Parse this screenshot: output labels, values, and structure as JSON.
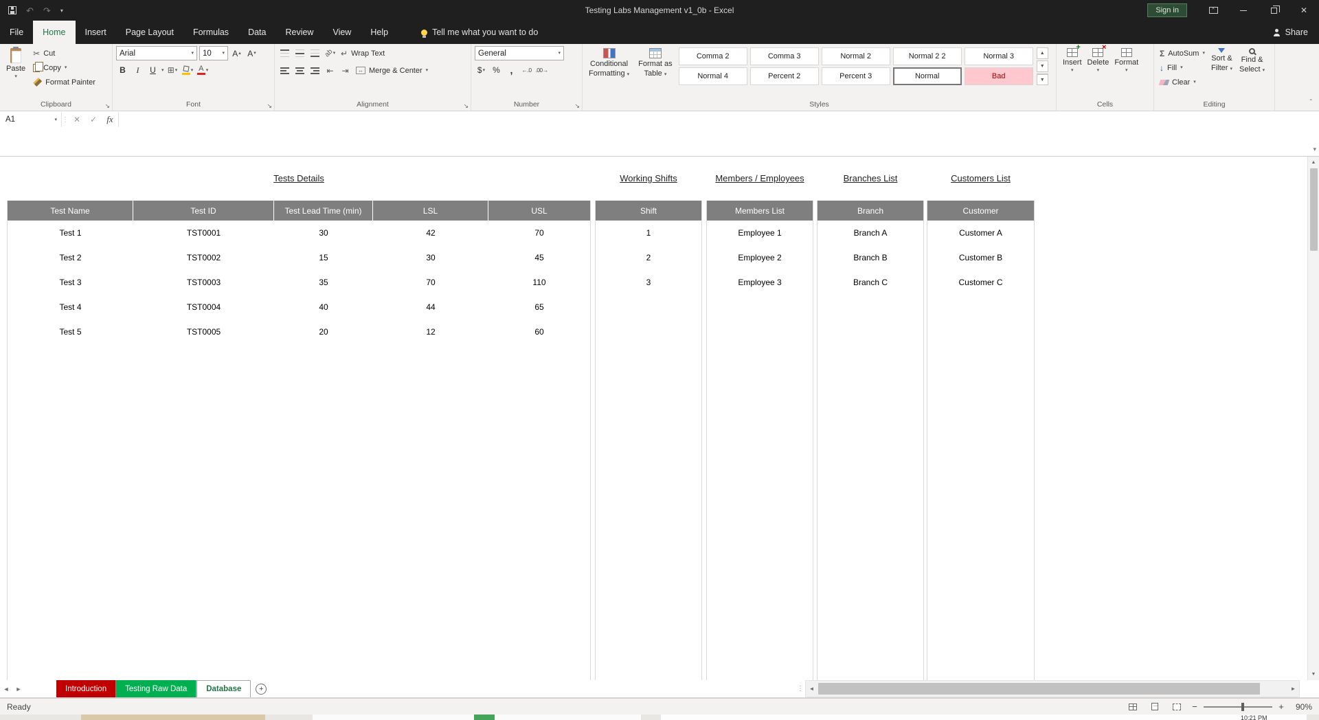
{
  "titlebar": {
    "title": "Testing Labs Management v1_0b  -  Excel",
    "sign_in": "Sign in"
  },
  "menu": {
    "tabs": [
      {
        "label": "File"
      },
      {
        "label": "Home"
      },
      {
        "label": "Insert"
      },
      {
        "label": "Page Layout"
      },
      {
        "label": "Formulas"
      },
      {
        "label": "Data"
      },
      {
        "label": "Review"
      },
      {
        "label": "View"
      },
      {
        "label": "Help"
      }
    ],
    "tell_me": "Tell me what you want to do",
    "share": "Share"
  },
  "ribbon": {
    "groups": [
      "Clipboard",
      "Font",
      "Alignment",
      "Number",
      "Styles",
      "Cells",
      "Editing"
    ],
    "clipboard": {
      "paste": "Paste",
      "cut": "Cut",
      "copy": "Copy",
      "format_painter": "Format Painter"
    },
    "font": {
      "name": "Arial",
      "size": "10"
    },
    "alignment": {
      "wrap": "Wrap Text",
      "merge": "Merge & Center"
    },
    "number": {
      "format": "General"
    },
    "styles": {
      "conditional": [
        "Conditional",
        "Formatting"
      ],
      "format_table": [
        "Format as",
        "Table"
      ],
      "gallery": [
        [
          "Comma 2",
          "Comma 3",
          "Normal 2",
          "Normal 2 2",
          "Normal 3"
        ],
        [
          "Normal 4",
          "Percent 2",
          "Percent 3",
          "Normal",
          "Bad"
        ]
      ]
    },
    "cells": {
      "insert": "Insert",
      "delete": "Delete",
      "format": "Format"
    },
    "editing": {
      "autosum": "AutoSum",
      "fill": "Fill",
      "clear": "Clear",
      "sort": [
        "Sort &",
        "Filter"
      ],
      "find": [
        "Find &",
        "Select"
      ]
    }
  },
  "formula_bar": {
    "name_box": "A1"
  },
  "sheet": {
    "sections": [
      {
        "title": "Tests Details",
        "columns": [
          "Test Name",
          "Test ID",
          "Test Lead Time (min)",
          "LSL",
          "USL"
        ],
        "rows": [
          [
            "Test 1",
            "TST0001",
            "30",
            "42",
            "70"
          ],
          [
            "Test 2",
            "TST0002",
            "15",
            "30",
            "45"
          ],
          [
            "Test 3",
            "TST0003",
            "35",
            "70",
            "110"
          ],
          [
            "Test 4",
            "TST0004",
            "40",
            "44",
            "65"
          ],
          [
            "Test 5",
            "TST0005",
            "20",
            "12",
            "60"
          ]
        ]
      },
      {
        "title": "Working Shifts",
        "columns": [
          "Shift"
        ],
        "rows": [
          [
            "1"
          ],
          [
            "2"
          ],
          [
            "3"
          ]
        ]
      },
      {
        "title": "Members / Employees",
        "columns": [
          "Members List"
        ],
        "rows": [
          [
            "Employee 1"
          ],
          [
            "Employee 2"
          ],
          [
            "Employee 3"
          ]
        ]
      },
      {
        "title": "Branches List",
        "columns": [
          "Branch"
        ],
        "rows": [
          [
            "Branch A"
          ],
          [
            "Branch B"
          ],
          [
            "Branch C"
          ]
        ]
      },
      {
        "title": "Customers List",
        "columns": [
          "Customer"
        ],
        "rows": [
          [
            "Customer A"
          ],
          [
            "Customer B"
          ],
          [
            "Customer C"
          ]
        ]
      }
    ]
  },
  "sheet_tabs": {
    "tabs": [
      {
        "label": "Introduction",
        "color": "#C00000"
      },
      {
        "label": "Testing Raw Data",
        "color": "#00B050"
      },
      {
        "label": "Database",
        "color": "#FFFFFF"
      }
    ]
  },
  "status_bar": {
    "mode": "Ready",
    "zoom": "90%"
  },
  "taskbar": {
    "time": "10:21 PM"
  },
  "colors": {
    "excel_green": "#217346",
    "tab_red": "#C00000",
    "tab_green": "#00B050",
    "bad_bg": "#FFC7CE",
    "bad_text": "#9C0006",
    "header_gray": "#7F7F7F"
  }
}
